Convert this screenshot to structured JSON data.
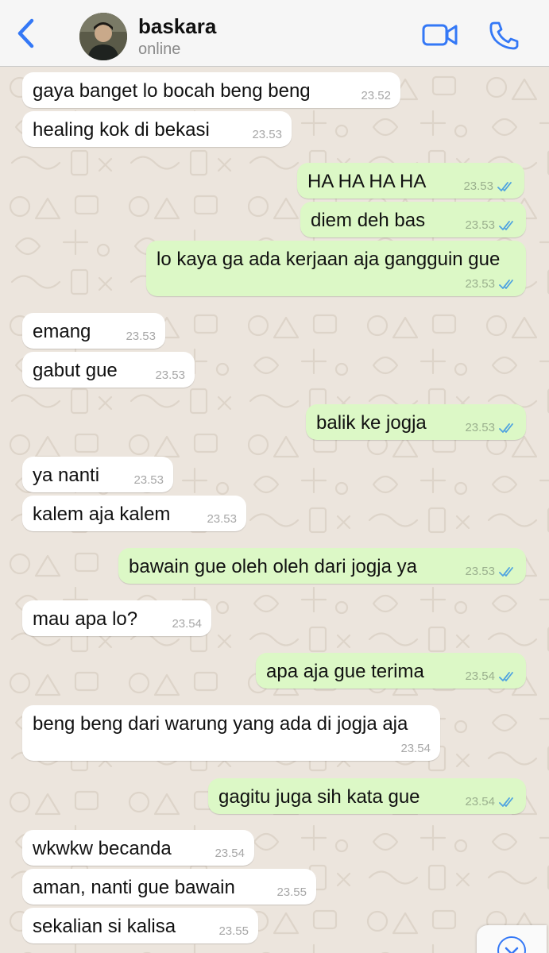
{
  "header": {
    "contact_name": "baskara",
    "status": "online",
    "back_icon": "chevron-left-icon",
    "video_icon": "video-camera-icon",
    "call_icon": "phone-icon",
    "accent_color": "#3478f6"
  },
  "messages": [
    {
      "dir": "in",
      "text": "gaya banget lo bocah beng beng",
      "time": "23.52"
    },
    {
      "dir": "in",
      "text": "healing kok di bekasi",
      "time": "23.53"
    },
    {
      "dir": "out",
      "text": "HA HA HA HA",
      "time": "23.53",
      "read": true
    },
    {
      "dir": "out",
      "text": "diem deh bas",
      "time": "23.53",
      "read": true
    },
    {
      "dir": "out",
      "text": "lo kaya ga ada kerjaan aja gangguin gue",
      "time": "23.53",
      "read": true
    },
    {
      "dir": "in",
      "text": "emang",
      "time": "23.53"
    },
    {
      "dir": "in",
      "text": "gabut gue",
      "time": "23.53"
    },
    {
      "dir": "out",
      "text": "balik ke jogja",
      "time": "23.53",
      "read": true
    },
    {
      "dir": "in",
      "text": "ya nanti",
      "time": "23.53"
    },
    {
      "dir": "in",
      "text": "kalem aja kalem",
      "time": "23.53"
    },
    {
      "dir": "out",
      "text": "bawain gue oleh oleh dari jogja ya",
      "time": "23.53",
      "read": true
    },
    {
      "dir": "in",
      "text": "mau apa lo?",
      "time": "23.54"
    },
    {
      "dir": "out",
      "text": "apa aja gue terima",
      "time": "23.54",
      "read": true
    },
    {
      "dir": "in",
      "text": "beng beng dari warung yang ada di jogja aja",
      "time": "23.54"
    },
    {
      "dir": "out",
      "text": "gagitu juga sih kata gue",
      "time": "23.54",
      "read": true
    },
    {
      "dir": "in",
      "text": "wkwkw becanda",
      "time": "23.54"
    },
    {
      "dir": "in",
      "text": "aman, nanti gue bawain",
      "time": "23.55"
    },
    {
      "dir": "in",
      "text": "sekalian si kalisa",
      "time": "23.55"
    }
  ],
  "colors": {
    "incoming_bubble": "#ffffff",
    "outgoing_bubble": "#dcf8c6",
    "read_tick": "#4fa3e0",
    "chat_background": "#ece5dd"
  },
  "scroll_down_icon": "chevron-down-circle-icon"
}
